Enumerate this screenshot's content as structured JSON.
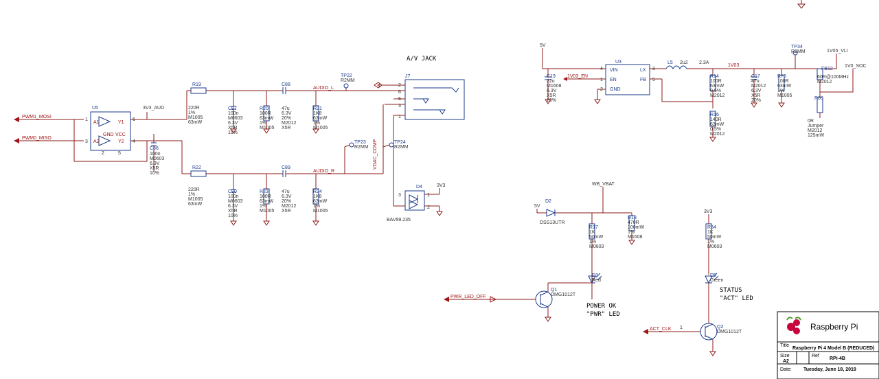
{
  "title_block": {
    "brand": "Raspberry Pi",
    "title": "Raspberry Pi 4 Model B (REDUCED)",
    "size_label": "Size",
    "size": "A2",
    "ref_label": "Ref",
    "ref": "RPi-4B",
    "date_label": "Date:",
    "date": "Tuesday, June 18, 2019"
  },
  "section_labels": {
    "av_jack": "A/V JACK",
    "power_ok": "POWER OK",
    "pwr_led": "\"PWR\" LED",
    "status": "STATUS",
    "act_led": "\"ACT\" LED"
  },
  "nets": {
    "pwm1_mosi": "PWM1_MOSI",
    "pwm0_miso": "PWM0_MISO",
    "3v3_aud": "3V3_AUD",
    "audio_l": "AUDIO_L",
    "audio_r": "AUDIO_R",
    "vdac_comp": "VDAC_COMP",
    "3v3": "3V3",
    "5v_a": "5V",
    "5v_b": "5V",
    "1v03_en": "1V03_EN",
    "1v03": "1V03",
    "1v05_vli": "1V05_VLI",
    "1v0_soc": "1V0_SOC",
    "wb_vbat": "WB_VBAT",
    "pwr_led_off": "PWR_LED_OFF",
    "act_clk": "ACT_CLK"
  },
  "components": {
    "U5": {
      "ref": "U5",
      "pins": {
        "a1": "A1",
        "a2": "A2",
        "y1": "Y1",
        "y2": "Y2",
        "gnd": "GND",
        "vcc": "VCC"
      }
    },
    "C86": {
      "ref": "C86",
      "v1": "100n",
      "v2": "M0603",
      "v3": "6.3V",
      "v4": "X5R",
      "v5": "10%"
    },
    "R19": {
      "ref": "R19",
      "v1": "220R",
      "v2": "1%",
      "v3": "M1005",
      "v4": "63mW"
    },
    "R22": {
      "ref": "R22",
      "v1": "220R",
      "v2": "1%",
      "v3": "M1005",
      "v4": "63mW"
    },
    "C87": {
      "ref": "C87",
      "v1": "100n",
      "v2": "M0603",
      "v3": "6.3V",
      "v4": "X5R",
      "v5": "10%"
    },
    "C90": {
      "ref": "C90",
      "v1": "100n",
      "v2": "M0603",
      "v3": "6.3V",
      "v4": "X5R",
      "v5": "10%"
    },
    "R20": {
      "ref": "R20",
      "v1": "100R",
      "v2": "63mW",
      "v3": "1%",
      "v4": "M1005"
    },
    "R23": {
      "ref": "R23",
      "v1": "100R",
      "v2": "63mW",
      "v3": "1%",
      "v4": "M1005"
    },
    "C88": {
      "ref": "C88",
      "v1": "47u",
      "v2": "6.3V",
      "v3": "20%",
      "v4": "M2012",
      "v5": "X5R"
    },
    "C89": {
      "ref": "C89",
      "v1": "47u",
      "v2": "6.3V",
      "v3": "20%",
      "v4": "M2012",
      "v5": "X5R"
    },
    "R21": {
      "ref": "R21",
      "v1": "1K8",
      "v2": "63mW",
      "v3": "1%",
      "v4": "M1005"
    },
    "R24": {
      "ref": "R24",
      "v1": "1K8",
      "v2": "63mW",
      "v3": "1%",
      "v4": "M1005"
    },
    "TP22": {
      "ref": "TP22",
      "v1": "R2MM"
    },
    "TP23": {
      "ref": "TP23",
      "v1": "R2MM"
    },
    "TP24": {
      "ref": "TP24",
      "v1": "R2MM"
    },
    "TP34": {
      "ref": "TP34",
      "v1": "R2MM"
    },
    "J7": {
      "ref": "J7"
    },
    "D4": {
      "ref": "D4",
      "v1": "BAV99.235"
    },
    "C19": {
      "ref": "C19",
      "v1": "22u",
      "v2": "M1608",
      "v3": "6.3V",
      "v4": "X5R",
      "v5": "20%"
    },
    "U3": {
      "ref": "U3",
      "pins": {
        "vin": "VIN",
        "en": "EN",
        "gnd": "GND",
        "lx": "LX",
        "fb": "FB"
      }
    },
    "L5": {
      "ref": "L5",
      "v1": "2u2",
      "v2": "2.3A"
    },
    "R14": {
      "ref": "R14",
      "v1": "100R",
      "v2": "63mW",
      "v3": "0.5%",
      "v4": "M2012"
    },
    "R16": {
      "ref": "R16",
      "v1": "140R",
      "v2": "63mW",
      "v3": "0.5%",
      "v4": "M2012"
    },
    "C17": {
      "ref": "C17",
      "v1": "47u",
      "v2": "M2012",
      "v3": "6.3V",
      "v4": "X5R",
      "v5": "20%"
    },
    "R76": {
      "ref": "R76",
      "v1": "100R",
      "v2": "63mW",
      "v3": "1%",
      "v4": "M1005"
    },
    "FB12": {
      "ref": "FB12",
      "v1": "60R@100MHz",
      "v2": "M2012"
    },
    "R85": {
      "ref": "R85",
      "v1": "0R",
      "v2": "Jumper",
      "v3": "M2012",
      "v4": "125mW"
    },
    "D2": {
      "ref": "D2",
      "v1": "DSS13UTR"
    },
    "R17": {
      "ref": "R17",
      "v1": "1K",
      "v2": "50mW",
      "v3": "1%",
      "v4": "M0603"
    },
    "R13": {
      "ref": "R13",
      "v1": "470R",
      "v2": "100mW",
      "v3": "1%",
      "v4": "M1608"
    },
    "D3": {
      "ref": "D3",
      "v1": "Red"
    },
    "Q1": {
      "ref": "Q1",
      "v1": "DMG1012T"
    },
    "R34": {
      "ref": "R34",
      "v1": "1K",
      "v2": "50mW",
      "v3": "1%",
      "v4": "M0603"
    },
    "D5": {
      "ref": "D5",
      "v1": "Green"
    },
    "Q2": {
      "ref": "Q2",
      "v1": "DMG1012T"
    }
  }
}
